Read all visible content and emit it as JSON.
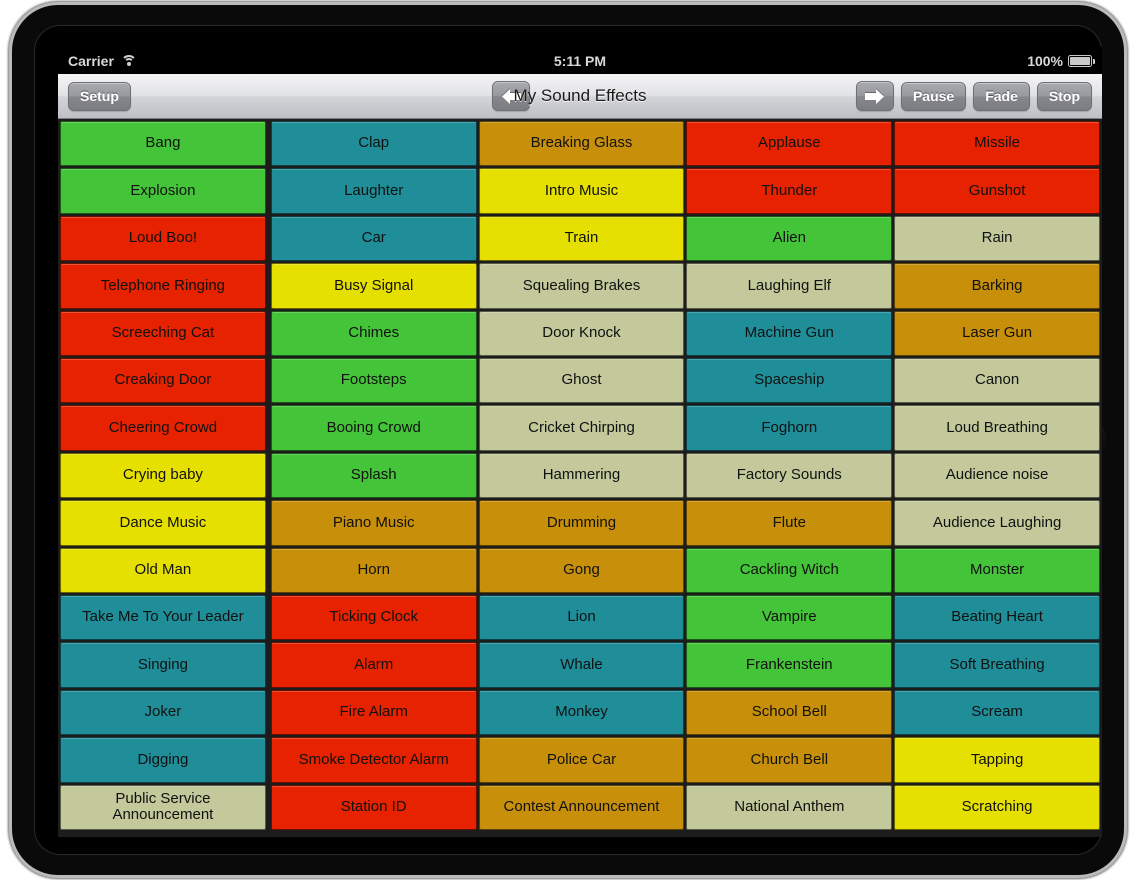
{
  "status_bar": {
    "carrier": "Carrier",
    "wifi_icon": "wifi-icon",
    "time": "5:11 PM",
    "battery_percent": "100%",
    "battery_icon": "battery-icon"
  },
  "toolbar": {
    "setup_label": "Setup",
    "back_icon": "arrow-left-icon",
    "forward_icon": "arrow-right-icon",
    "title": "My Sound Effects",
    "pause_label": "Pause",
    "fade_label": "Fade",
    "stop_label": "Stop"
  },
  "colors": {
    "green": "#44c438",
    "teal": "#1f8e99",
    "gold": "#c8900a",
    "yellow": "#e6e000",
    "red": "#e62200",
    "tan": "#c3c99b"
  },
  "grid": {
    "columns": 5,
    "rows": 15,
    "pads": [
      [
        {
          "label": "Bang",
          "color": "green"
        },
        {
          "label": "Clap",
          "color": "teal"
        },
        {
          "label": "Breaking Glass",
          "color": "gold"
        },
        {
          "label": "Applause",
          "color": "red"
        },
        {
          "label": "Missile",
          "color": "red"
        }
      ],
      [
        {
          "label": "Explosion",
          "color": "green"
        },
        {
          "label": "Laughter",
          "color": "teal"
        },
        {
          "label": "Intro Music",
          "color": "yellow"
        },
        {
          "label": "Thunder",
          "color": "red"
        },
        {
          "label": "Gunshot",
          "color": "red"
        }
      ],
      [
        {
          "label": "Loud Boo!",
          "color": "red"
        },
        {
          "label": "Car",
          "color": "teal"
        },
        {
          "label": "Train",
          "color": "yellow"
        },
        {
          "label": "Alien",
          "color": "green"
        },
        {
          "label": "Rain",
          "color": "tan"
        }
      ],
      [
        {
          "label": "Telephone Ringing",
          "color": "red"
        },
        {
          "label": "Busy Signal",
          "color": "yellow"
        },
        {
          "label": "Squealing Brakes",
          "color": "tan"
        },
        {
          "label": "Laughing Elf",
          "color": "tan"
        },
        {
          "label": "Barking",
          "color": "gold"
        }
      ],
      [
        {
          "label": "Screeching Cat",
          "color": "red"
        },
        {
          "label": "Chimes",
          "color": "green"
        },
        {
          "label": "Door Knock",
          "color": "tan"
        },
        {
          "label": "Machine Gun",
          "color": "teal"
        },
        {
          "label": "Laser Gun",
          "color": "gold"
        }
      ],
      [
        {
          "label": "Creaking Door",
          "color": "red"
        },
        {
          "label": "Footsteps",
          "color": "green"
        },
        {
          "label": "Ghost",
          "color": "tan"
        },
        {
          "label": "Spaceship",
          "color": "teal"
        },
        {
          "label": "Canon",
          "color": "tan"
        }
      ],
      [
        {
          "label": "Cheering Crowd",
          "color": "red"
        },
        {
          "label": "Booing Crowd",
          "color": "green"
        },
        {
          "label": "Cricket Chirping",
          "color": "tan"
        },
        {
          "label": "Foghorn",
          "color": "teal"
        },
        {
          "label": "Loud Breathing",
          "color": "tan"
        }
      ],
      [
        {
          "label": "Crying baby",
          "color": "yellow"
        },
        {
          "label": "Splash",
          "color": "green"
        },
        {
          "label": "Hammering",
          "color": "tan"
        },
        {
          "label": "Factory Sounds",
          "color": "tan"
        },
        {
          "label": "Audience noise",
          "color": "tan"
        }
      ],
      [
        {
          "label": "Dance Music",
          "color": "yellow"
        },
        {
          "label": "Piano Music",
          "color": "gold"
        },
        {
          "label": "Drumming",
          "color": "gold"
        },
        {
          "label": "Flute",
          "color": "gold"
        },
        {
          "label": "Audience Laughing",
          "color": "tan"
        }
      ],
      [
        {
          "label": "Old Man",
          "color": "yellow"
        },
        {
          "label": "Horn",
          "color": "gold"
        },
        {
          "label": "Gong",
          "color": "gold"
        },
        {
          "label": "Cackling Witch",
          "color": "green"
        },
        {
          "label": "Monster",
          "color": "green"
        }
      ],
      [
        {
          "label": "Take Me To Your Leader",
          "color": "teal"
        },
        {
          "label": "Ticking Clock",
          "color": "red"
        },
        {
          "label": "Lion",
          "color": "teal"
        },
        {
          "label": "Vampire",
          "color": "green"
        },
        {
          "label": "Beating Heart",
          "color": "teal"
        }
      ],
      [
        {
          "label": "Singing",
          "color": "teal"
        },
        {
          "label": "Alarm",
          "color": "red"
        },
        {
          "label": "Whale",
          "color": "teal"
        },
        {
          "label": "Frankenstein",
          "color": "green"
        },
        {
          "label": "Soft Breathing",
          "color": "teal"
        }
      ],
      [
        {
          "label": "Joker",
          "color": "teal"
        },
        {
          "label": "Fire Alarm",
          "color": "red"
        },
        {
          "label": "Monkey",
          "color": "teal"
        },
        {
          "label": "School Bell",
          "color": "gold"
        },
        {
          "label": "Scream",
          "color": "teal"
        }
      ],
      [
        {
          "label": "Digging",
          "color": "teal"
        },
        {
          "label": "Smoke Detector Alarm",
          "color": "red"
        },
        {
          "label": "Police Car",
          "color": "gold"
        },
        {
          "label": "Church Bell",
          "color": "gold"
        },
        {
          "label": "Tapping",
          "color": "yellow"
        }
      ],
      [
        {
          "label": "Public Service Announcement",
          "color": "tan"
        },
        {
          "label": "Station ID",
          "color": "red"
        },
        {
          "label": "Contest Announcement",
          "color": "gold"
        },
        {
          "label": "National Anthem",
          "color": "tan"
        },
        {
          "label": "Scratching",
          "color": "yellow"
        }
      ]
    ]
  }
}
